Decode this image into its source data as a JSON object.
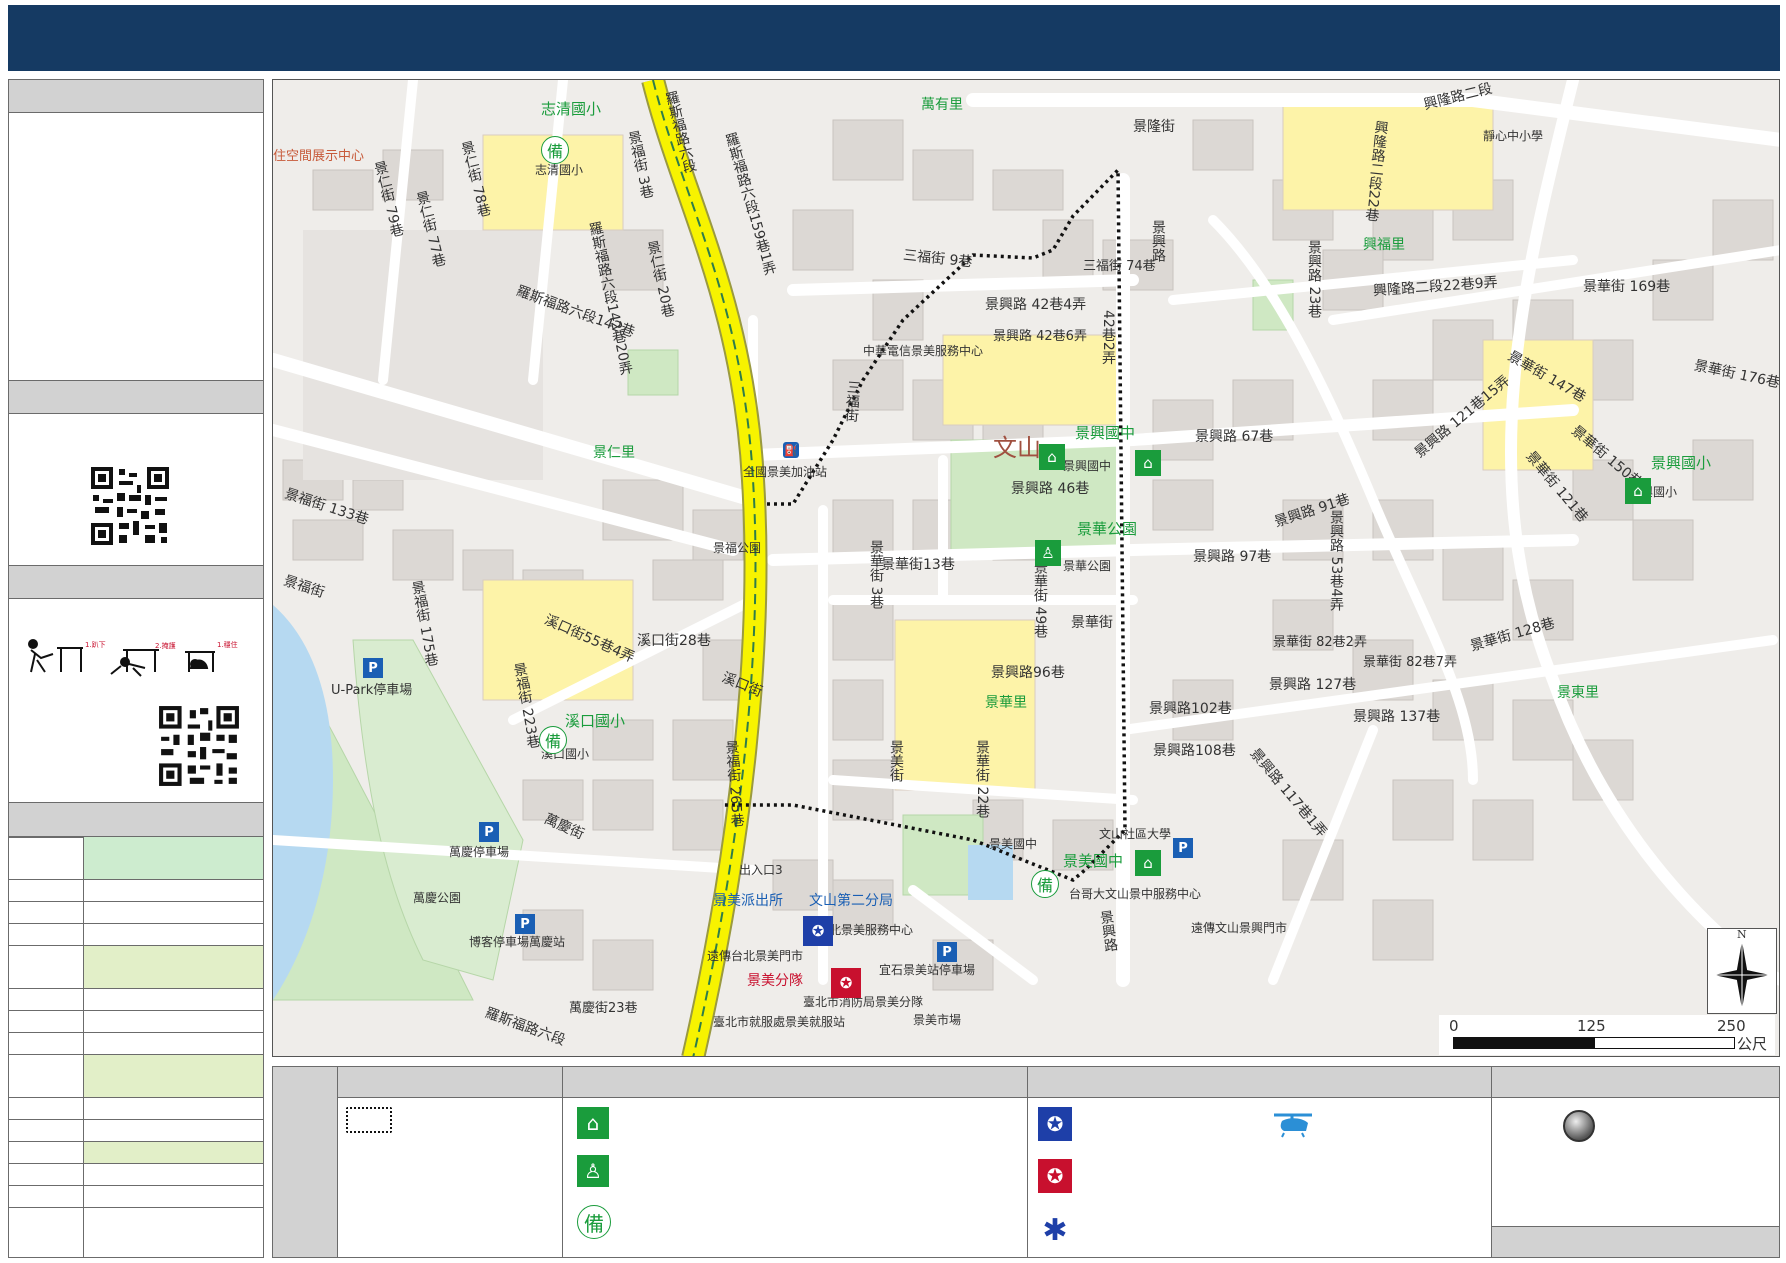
{
  "labels": {
    "l01": "志清國小",
    "l02": "志清國小",
    "l03": "萬有里",
    "l04": "景隆街",
    "l05": "興隆路二段",
    "l06": "靜心中小學",
    "l07": "羅斯福路六段",
    "l08": "羅斯福路六段159巷1弄",
    "l09": "羅斯福路六段142巷20弄",
    "l10": "羅斯福路六段142巷",
    "l11": "景仁街 79巷",
    "l12": "景仁街 77巷",
    "l13": "景仁街 78巷",
    "l14": "景福街 3巷",
    "l15": "景仁街 20巷",
    "l16": "三福街 9巷",
    "l17": "三福街",
    "l18": "三福街 74巷",
    "l19": "景興路 42巷4弄",
    "l20": "景興路 42巷6弄",
    "l21": "42巷2弄",
    "l22": "景興路",
    "l23": "興隆路二段22巷9弄",
    "l24": "興福里",
    "l25": "中華電信景美服務中心",
    "l26": "景仁里",
    "l27": "全國景美加油站",
    "l28": "景興國中",
    "l29": "景興國中",
    "l30": "文山",
    "l31": "景興路 46巷",
    "l32": "景興路 67巷",
    "l33": "景華公園",
    "l34": "景華公園",
    "l35": "景福公園",
    "l36": "景華街13巷",
    "l37": "景華街 49巷",
    "l38": "景華街",
    "l39": "景興路 91巷",
    "l40": "景興路 97巷",
    "l41": "景興國小",
    "l42": "景興國小",
    "l43": "溪口街28巷",
    "l44": "溪口街55巷4弄",
    "l45": "溪口國小",
    "l46": "溪口國小",
    "l47": "U-Park停車場",
    "l48": "景興路96巷",
    "l49": "景華里",
    "l50": "景興路102巷",
    "l51": "景興路108巷",
    "l52": "景華街 22巷",
    "l53": "景興路 127巷",
    "l54": "景興路 137巷",
    "l55": "景東里",
    "l56": "文山社區大學",
    "l57": "景美國中",
    "l58": "景美國中",
    "l59": "台哥大文山景中服務中心",
    "l60": "萬慶停車場",
    "l61": "萬慶公園",
    "l62": "博客停車場萬慶站",
    "l63": "出入口3",
    "l64": "景美派出所",
    "l65": "文山第二分局",
    "l66": "北景美服務中心",
    "l67": "遠傳台北景美門市",
    "l68": "景美分隊",
    "l69": "臺北市消防局景美分隊",
    "l70": "臺北市就服處景美就服站",
    "l71": "萬慶街23巷",
    "l72": "宜石景美站停車場",
    "l73": "景美市場",
    "l74": "景福街 265巷",
    "l75": "景美街",
    "l76": "景華街 3巷",
    "l77": "景福街 223巷",
    "l78": "景福街 175巷",
    "l79": "溪口街",
    "l80": "景福街",
    "l81": "萬慶街",
    "l82": "景華街 128巷",
    "l83": "景華街 82巷7弄",
    "l84": "景華街 82巷2弄",
    "l85": "景華街 147巷",
    "l86": "景華街 150巷",
    "l87": "景華街 169巷",
    "l88": "景華街 121巷",
    "l89": "景興路 121巷15弄",
    "l90": "景興路 53巷4弄",
    "l91": "景興路 23巷",
    "l92": "興隆路二段22巷",
    "l93": "景興路 117巷1弄",
    "l94": "景興路",
    "l95": "遠傳文山景興門市",
    "l96": "羅斯福路六段",
    "l97": "景福街 133巷",
    "l98": "住空間展示中心",
    "l99": "景華街 176巷6弄"
  },
  "scale": {
    "zero": "0",
    "mid": "125",
    "max": "250",
    "unit": "公尺"
  },
  "compass": {
    "north": "N"
  },
  "colors": {
    "header": "#153a63",
    "route": "#111111",
    "school": "#fff3a6",
    "park": "#cfe8c3",
    "road_main": "#f7f300"
  },
  "icons": {
    "shelter": "shelter-icon",
    "park_refuge": "park-refuge-icon",
    "reserve": "reserve-icon",
    "police": "police-icon",
    "fire": "fire-icon",
    "medical": "medical-icon",
    "helipad": "helicopter-icon",
    "point": "point-marker-icon",
    "qr": "qr-code-icon",
    "drop_cover": "drop-cover-hold-icon"
  },
  "earthquake_steps": [
    "1.趴下",
    "2.掩護",
    "1.穩住"
  ]
}
